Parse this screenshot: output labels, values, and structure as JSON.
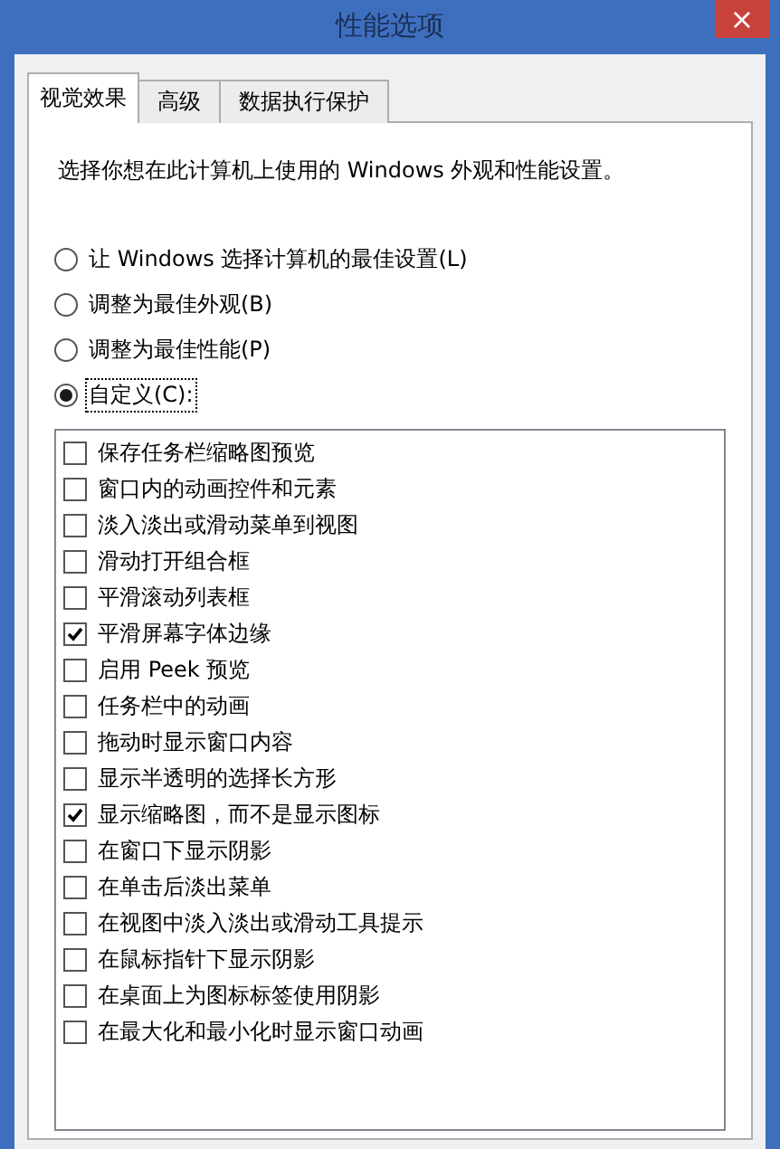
{
  "window": {
    "title": "性能选项",
    "close": "×"
  },
  "tabs": [
    {
      "label": "视觉效果",
      "selected": true
    },
    {
      "label": "高级",
      "selected": false
    },
    {
      "label": "数据执行保护",
      "selected": false
    }
  ],
  "description": "选择你想在此计算机上使用的 Windows 外观和性能设置。",
  "options": [
    {
      "label": "让 Windows 选择计算机的最佳设置(L)",
      "selected": false
    },
    {
      "label": "调整为最佳外观(B)",
      "selected": false
    },
    {
      "label": "调整为最佳性能(P)",
      "selected": false
    },
    {
      "label": "自定义(C):",
      "selected": true
    }
  ],
  "effects": [
    {
      "label": "保存任务栏缩略图预览",
      "checked": false
    },
    {
      "label": "窗口内的动画控件和元素",
      "checked": false
    },
    {
      "label": "淡入淡出或滑动菜单到视图",
      "checked": false
    },
    {
      "label": "滑动打开组合框",
      "checked": false
    },
    {
      "label": "平滑滚动列表框",
      "checked": false
    },
    {
      "label": "平滑屏幕字体边缘",
      "checked": true
    },
    {
      "label": "启用 Peek 预览",
      "checked": false
    },
    {
      "label": "任务栏中的动画",
      "checked": false
    },
    {
      "label": "拖动时显示窗口内容",
      "checked": false
    },
    {
      "label": "显示半透明的选择长方形",
      "checked": false
    },
    {
      "label": "显示缩略图，而不是显示图标",
      "checked": true
    },
    {
      "label": "在窗口下显示阴影",
      "checked": false
    },
    {
      "label": "在单击后淡出菜单",
      "checked": false
    },
    {
      "label": "在视图中淡入淡出或滑动工具提示",
      "checked": false
    },
    {
      "label": "在鼠标指针下显示阴影",
      "checked": false
    },
    {
      "label": "在桌面上为图标标签使用阴影",
      "checked": false
    },
    {
      "label": "在最大化和最小化时显示窗口动画",
      "checked": false
    }
  ]
}
